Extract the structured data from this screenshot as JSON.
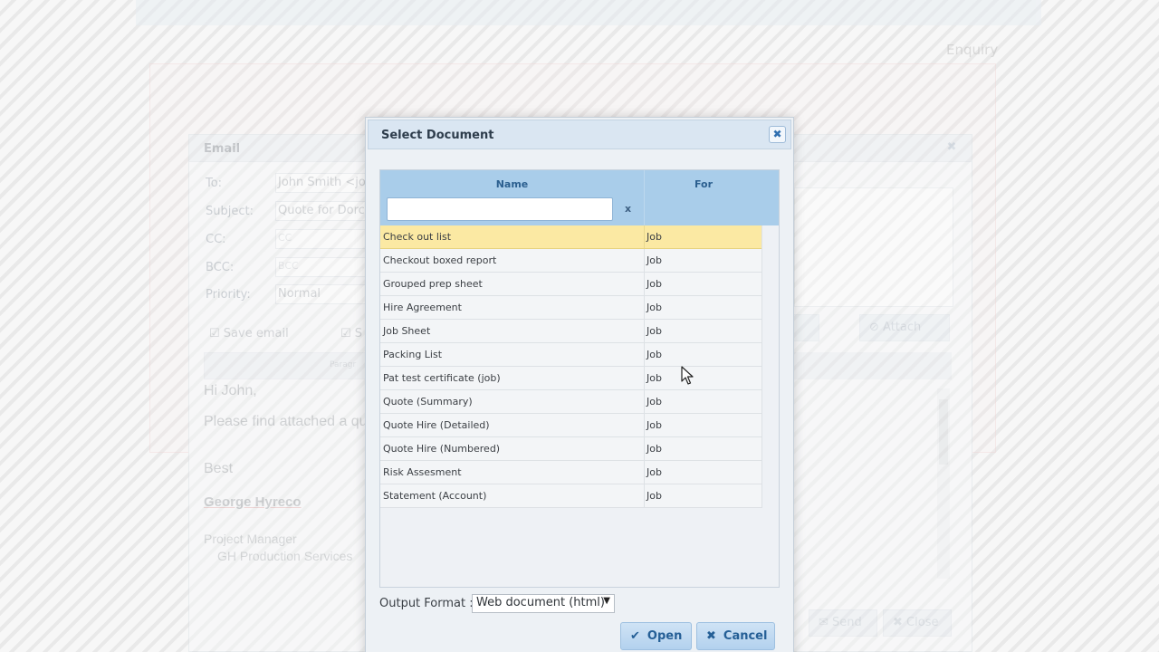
{
  "background": {
    "enquiry_label": "Enquiry",
    "email_dialog": {
      "title": "Email",
      "fields": [
        {
          "label": "To:",
          "value": "John Smith <joh"
        },
        {
          "label": "Subject:",
          "value": "Quote for Dorcl"
        },
        {
          "label": "CC:",
          "value": "CC"
        },
        {
          "label": "BCC:",
          "value": "BCC"
        },
        {
          "label": "Priority:",
          "value": "Normal"
        }
      ],
      "save_email_label": "Save email",
      "s_label": "S",
      "toolbar_paragraph": "Paragr",
      "attach_label": "Attach",
      "body_lines": [
        "Hi John,",
        "Please find attached a qu",
        "Best"
      ],
      "signature_name": "George Hyreco",
      "signature_title": "Project Manager",
      "signature_company": "GH Production Services",
      "send_label": "Send",
      "close_label": "Close"
    }
  },
  "dialog": {
    "title": "Select Document",
    "close_glyph": "✖",
    "columns": {
      "name": "Name",
      "for": "For"
    },
    "filter": {
      "value": "",
      "clear_label": "x"
    },
    "rows": [
      {
        "name": "Check out list",
        "for": "Job",
        "selected": true
      },
      {
        "name": "Checkout boxed report",
        "for": "Job"
      },
      {
        "name": "Grouped prep sheet",
        "for": "Job"
      },
      {
        "name": "Hire Agreement",
        "for": "Job"
      },
      {
        "name": "Job Sheet",
        "for": "Job"
      },
      {
        "name": "Packing List",
        "for": "Job"
      },
      {
        "name": "Pat test certificate (job)",
        "for": "Job"
      },
      {
        "name": "Quote (Summary)",
        "for": "Job"
      },
      {
        "name": "Quote Hire (Detailed)",
        "for": "Job"
      },
      {
        "name": "Quote Hire (Numbered)",
        "for": "Job"
      },
      {
        "name": "Risk Assesment",
        "for": "Job"
      },
      {
        "name": "Statement (Account)",
        "for": "Job"
      }
    ],
    "output_format": {
      "label": "Output Format :",
      "selected": "Web document (html)"
    },
    "buttons": {
      "open": "Open",
      "cancel": "Cancel"
    }
  },
  "colors": {
    "selected_row": "#fbe9a3",
    "header": "#a9cdea",
    "button": "#b3d1ee",
    "button_text": "#255f96"
  }
}
